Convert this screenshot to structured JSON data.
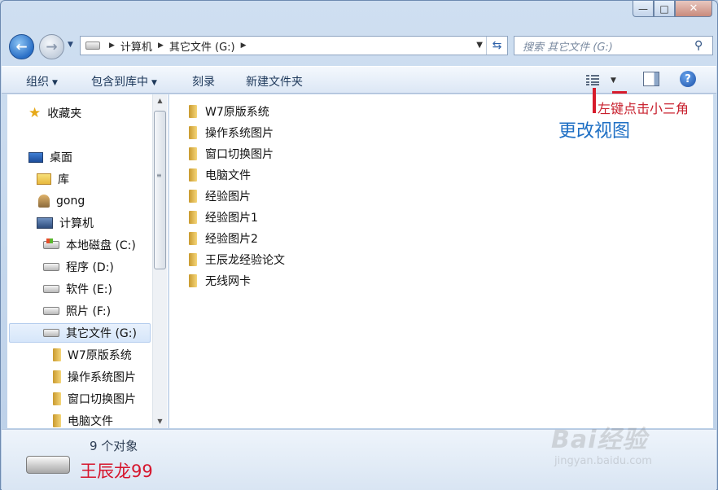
{
  "window": {
    "controls": {
      "minimize": "—",
      "maximize": "□",
      "close": "✕"
    }
  },
  "address": {
    "crumbs": [
      "计算机",
      "其它文件 (G:)"
    ],
    "search_placeholder": "搜索 其它文件 (G:)"
  },
  "toolbar": {
    "organize": "组织",
    "include_library": "包含到库中",
    "burn": "刻录",
    "new_folder": "新建文件夹"
  },
  "nav_tree": {
    "favorites": "收藏夹",
    "desktop": "桌面",
    "library": "库",
    "user": "gong",
    "computer": "计算机",
    "drives": [
      "本地磁盘 (C:)",
      "程序 (D:)",
      "软件 (E:)",
      "照片 (F:)",
      "其它文件 (G:)"
    ],
    "selected_drive": "其它文件 (G:)",
    "subfolders": [
      "W7原版系统",
      "操作系统图片",
      "窗口切换图片",
      "电脑文件"
    ]
  },
  "files": [
    "W7原版系统",
    "操作系统图片",
    "窗口切换图片",
    "电脑文件",
    "经验图片",
    "经验图片1",
    "经验图片2",
    "王辰龙经验论文",
    "无线网卡"
  ],
  "annotations": {
    "click_hint": "左键点击小三角",
    "change_view": "更改视图",
    "bar_color": "#d71b2b"
  },
  "details": {
    "item_count": "9 个对象",
    "author": "王辰龙99"
  },
  "watermark": {
    "brand": "Bai经验",
    "url": "jingyan.baidu.com"
  }
}
